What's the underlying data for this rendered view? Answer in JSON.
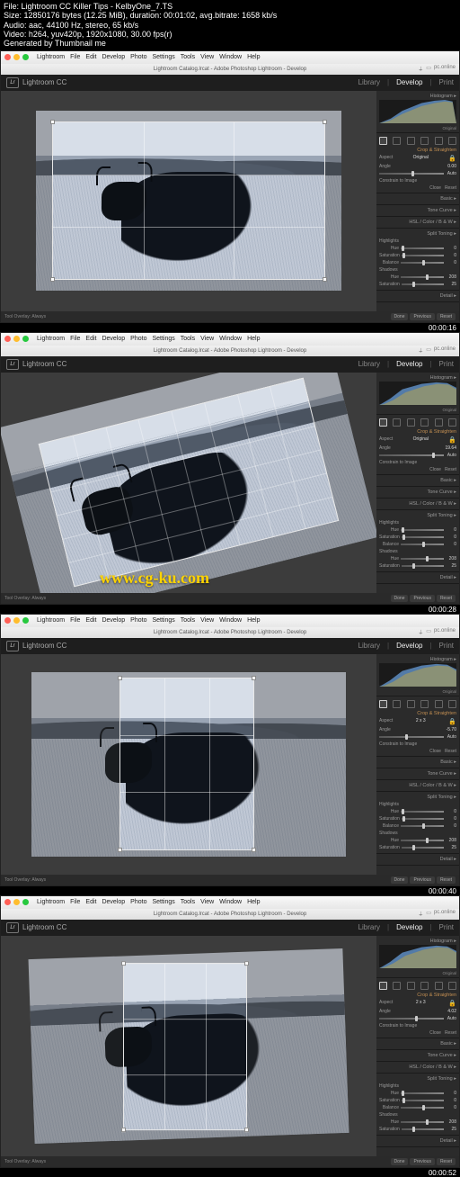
{
  "meta": {
    "file_line": "File: Lightroom CC Killer Tips - KelbyOne_7.TS",
    "size_line": "Size: 12850176 bytes (12.25 MiB), duration: 00:01:02, avg.bitrate: 1658 kb/s",
    "audio_line": "Audio: aac, 44100 Hz, stereo, 65 kb/s",
    "video_line": "Video: h264, yuv420p, 1920x1080, 30.00 fps(r)",
    "gen_line": "Generated by Thumbnail me"
  },
  "timestamps": [
    "00:00:16",
    "00:00:28",
    "00:00:40",
    "00:00:52"
  ],
  "mac_menu": [
    "Lightroom",
    "File",
    "Edit",
    "Develop",
    "Photo",
    "Settings",
    "Tools",
    "View",
    "Window",
    "Help"
  ],
  "doctitle": "Lightroom Catalog.lrcat - Adobe Photoshop Lightroom - Develop",
  "topbar_right": "pc.online",
  "logo_text": "Lightroom CC",
  "logo_mark": "Lr",
  "modules": {
    "library": "Library",
    "develop": "Develop",
    "print": "Print",
    "sep": "|"
  },
  "panel": {
    "histogram_label": "Histogram ▸",
    "original_label": "Original",
    "crop_label": "Crop & Straighten",
    "aspect_label": "Aspect",
    "aspect_val_orig": "Original",
    "aspect_val_23": "2 x 3",
    "angle_label": "Angle",
    "angle_vals": [
      "0.00",
      "19.64",
      "-5.70",
      "4.02"
    ],
    "auto": "Auto",
    "constrain": "Constrain to Image",
    "basic_label": "Basic ▸",
    "tonecurve_label": "Tone Curve ▸",
    "hsl_label": "HSL / Color / B & W ▸",
    "splittoning_label": "Split Toning ▸",
    "highlights_label": "Highlights",
    "hue_label": "Hue",
    "sat_label": "Saturation",
    "shadows_label": "Shadows",
    "balance_label": "Balance",
    "zero": "0",
    "val208": "208",
    "val25": "25",
    "detail_label": "Detail ▸",
    "close": "Close",
    "reset": "Reset",
    "done_label": "Done",
    "previous": "Previous",
    "reset_btn": "Reset",
    "tool_overlay": "Tool Overlay:",
    "tool_overlay_val": "Always"
  },
  "watermark": "www.cg-ku.com"
}
